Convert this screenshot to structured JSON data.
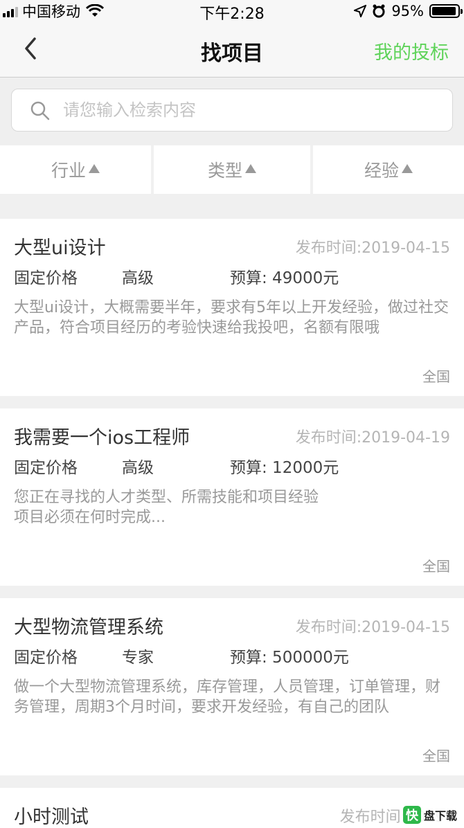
{
  "status_bar": {
    "carrier": "中国移动",
    "time": "下午2:28",
    "battery_text": "95%",
    "battery_level": 0.95,
    "icons": [
      "signal-icon",
      "wifi-icon",
      "location-icon",
      "alarm-icon",
      "battery-icon"
    ]
  },
  "nav": {
    "title": "找项目",
    "right_label": "我的投标",
    "right_color": "#5fd35a",
    "back_icon": "chevron-left-icon"
  },
  "search": {
    "placeholder": "请您输入检索内容",
    "value": "",
    "icon": "search-icon"
  },
  "filters": [
    {
      "label": "行业",
      "icon": "triangle-up-icon"
    },
    {
      "label": "类型",
      "icon": "triangle-up-icon"
    },
    {
      "label": "经验",
      "icon": "triangle-up-icon"
    }
  ],
  "projects": [
    {
      "title": "大型ui设计",
      "time": "发布时间:2019-04-15",
      "price_type": "固定价格",
      "level": "高级",
      "budget": "预算: 49000元",
      "desc": "大型ui设计，大概需要半年，要求有5年以上开发经验，做过社交产品，符合项目经历的考验快速给我投吧，名额有限哦",
      "region": "全国"
    },
    {
      "title": "我需要一个ios工程师",
      "time": "发布时间:2019-04-19",
      "price_type": "固定价格",
      "level": "高级",
      "budget": "预算: 12000元",
      "desc_line1": "您正在寻找的人才类型、所需技能和项目经验",
      "desc_line2": "项目必须在何时完成...",
      "region": "全国"
    },
    {
      "title": "大型物流管理系统",
      "time": "发布时间:2019-04-15",
      "price_type": "固定价格",
      "level": "专家",
      "budget": "预算: 500000元",
      "desc": "做一个大型物流管理系统，库存管理，人员管理，订单管理，财务管理，周期3个月时间，要求开发经验，有自己的团队",
      "region": "全国"
    },
    {
      "title": "小时测试",
      "time": "发布时间:2019-"
    }
  ],
  "watermark": {
    "logo_char": "快",
    "text": "盘下载"
  }
}
